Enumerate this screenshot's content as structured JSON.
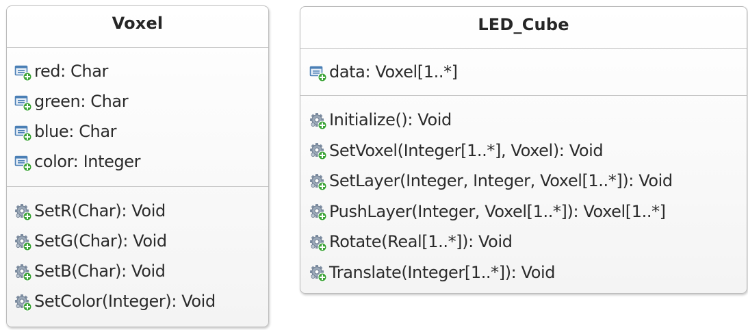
{
  "classes": [
    {
      "name": "Voxel",
      "attributes": [
        "red: Char",
        "green: Char",
        "blue: Char",
        "color: Integer"
      ],
      "operations": [
        "SetR(Char): Void",
        "SetG(Char): Void",
        "SetB(Char): Void",
        "SetColor(Integer): Void"
      ]
    },
    {
      "name": "LED_Cube",
      "attributes": [
        "data: Voxel[1..*]"
      ],
      "operations": [
        "Initialize(): Void",
        "SetVoxel(Integer[1..*], Voxel): Void",
        "SetLayer(Integer, Integer, Voxel[1..*]): Void",
        "PushLayer(Integer, Voxel[1..*]): Voxel[1..*]",
        "Rotate(Real[1..*]): Void",
        "Translate(Integer[1..*]): Void"
      ]
    }
  ],
  "icons": {
    "attribute": "attribute-add-icon",
    "operation": "operation-gear-add-icon"
  },
  "colors": {
    "border": "#bcbcbc",
    "text": "#2b2b2b",
    "icon_blue": "#4a7fb5",
    "icon_green": "#3aa335"
  }
}
